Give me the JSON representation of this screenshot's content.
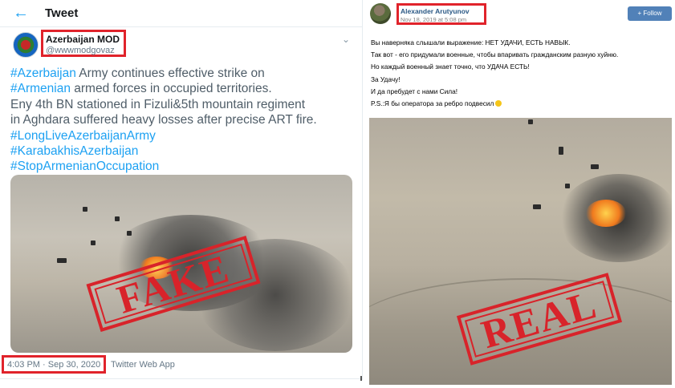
{
  "tweet": {
    "header_title": "Tweet",
    "author_name": "Azerbaijan MOD",
    "author_handle": "@wwwmodgovaz",
    "text_lines": [
      {
        "hashtag": "#Azerbaijan",
        "rest": " Army continues effective strike on"
      },
      {
        "hashtag": "#Armenian",
        "rest": " armed forces in occupied territories."
      },
      {
        "hashtag": "",
        "rest": "Eny 4th BN stationed in Fizuli&5th mountain regiment"
      },
      {
        "hashtag": "",
        "rest": "in Aghdara suffered heavy losses after precise ART fire."
      },
      {
        "hashtag": "#LongLiveAzerbaijanArmy",
        "rest": ""
      },
      {
        "hashtag": "#KarabakhisAzerbaijan",
        "rest": ""
      },
      {
        "hashtag": "#StopArmenianOccupation",
        "rest": ""
      }
    ],
    "timestamp": "4:03 PM · Sep 30, 2020",
    "source_app": "Twitter Web App",
    "stamp_label": "FAKE"
  },
  "vk_post": {
    "author_name": "Alexander Arutyunov",
    "date": "Nov 18, 2019 at 5:08 pm",
    "follow_label": "+ Follow",
    "text_lines": [
      "Вы наверняка слышали выражение: НЕТ УДАЧИ, ЕСТЬ НАВЫК.",
      "Так вот - его придумали военные, чтобы впаривать гражданским разную хуйню.",
      "Но каждый военный знает точно, что УДАЧА ЕСТЬ!",
      "За Удачу!",
      "И да пребудет с нами Сила!",
      "P.S.:Я бы оператора за ребро подвесил"
    ],
    "stamp_label": "REAL"
  },
  "colors": {
    "highlight_red": "#e0232b",
    "twitter_blue": "#1da1f2",
    "vk_blue": "#5181b8"
  },
  "icons": {
    "back": "arrow-left-icon",
    "caret": "chevron-down-icon"
  }
}
